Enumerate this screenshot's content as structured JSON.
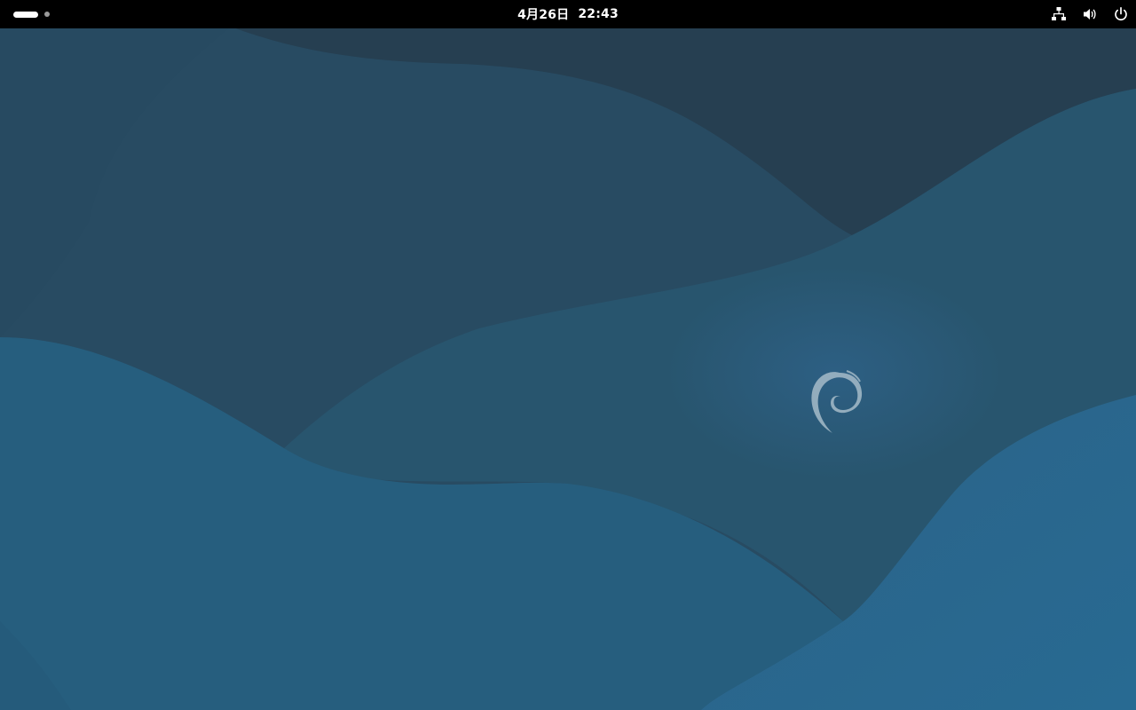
{
  "topbar": {
    "date": "4月26日",
    "time": "22:43"
  },
  "workspaces": {
    "count": 2,
    "active_index": 0
  },
  "status_icons": [
    "network-wired-icon",
    "volume-icon",
    "power-icon"
  ],
  "colors": {
    "topbar": "#000000",
    "wallpaper_base": "#254a60",
    "logo": "#9fb6c4"
  }
}
